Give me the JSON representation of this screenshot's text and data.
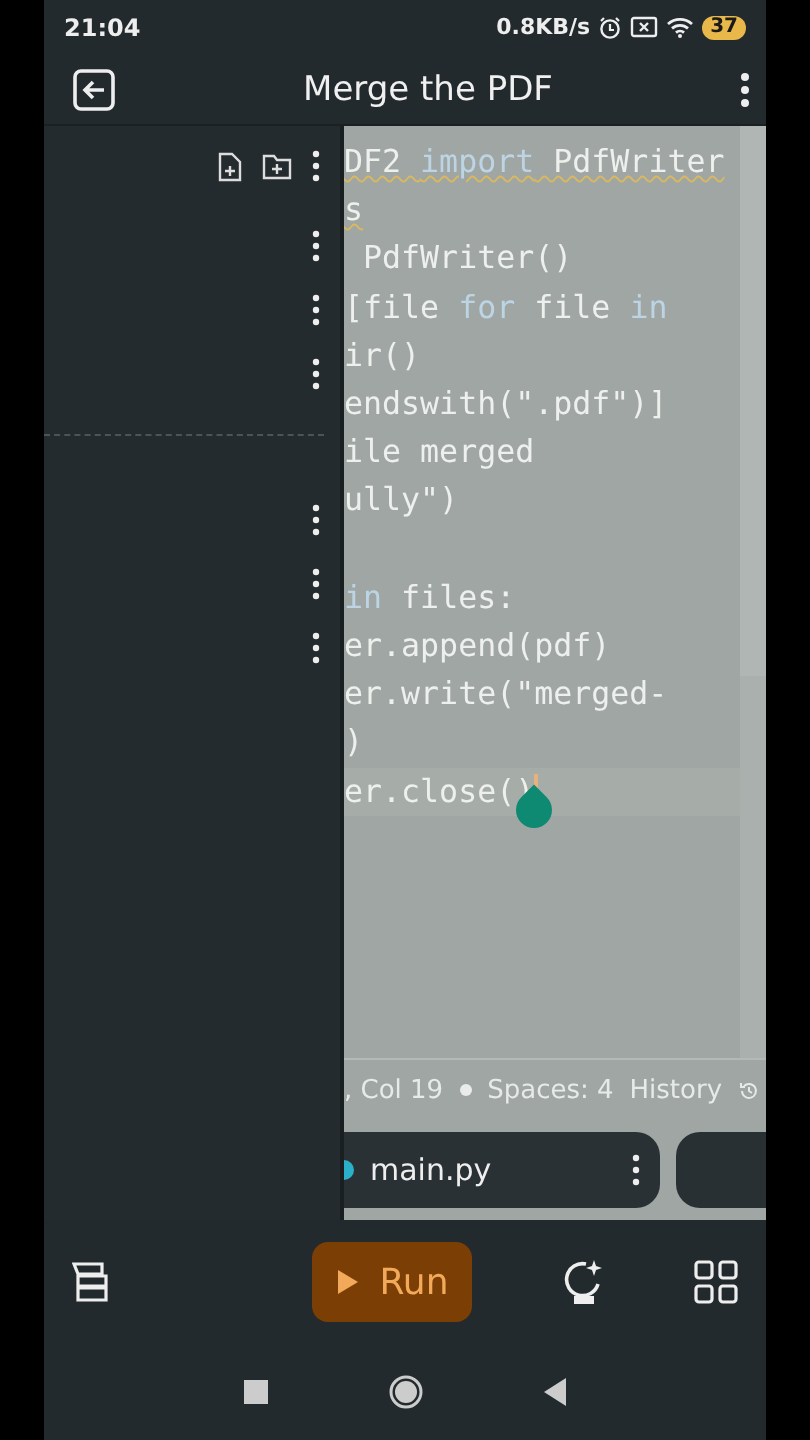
{
  "status_bar": {
    "time": "21:04",
    "speed": "0.8KB/s",
    "battery": "37"
  },
  "header": {
    "title": "Merge the PDF"
  },
  "sidebar": {
    "sections": [
      {
        "rows": [
          {
            "menu": true
          },
          {
            "menu": true
          },
          {
            "menu": true
          }
        ]
      },
      {
        "rows": [
          {
            "menu": true
          },
          {
            "menu": true
          },
          {
            "menu": true
          }
        ]
      }
    ]
  },
  "editor": {
    "lines": [
      {
        "segments": [
          {
            "text": "DF2 ",
            "kind": "plain"
          },
          {
            "text": "import",
            "kind": "keyword"
          },
          {
            "text": " PdfWriter",
            "kind": "plain"
          }
        ],
        "warning": true,
        "current": false,
        "gap_before": false
      },
      {
        "segments": [
          {
            "text": "s",
            "kind": "plain"
          }
        ],
        "warning": true,
        "current": false,
        "gap_before": false
      },
      {
        "segments": [
          {
            "text": " PdfWriter()",
            "kind": "plain"
          }
        ],
        "warning": false,
        "current": false,
        "gap_before": false
      },
      {
        "segments": [
          {
            "text": "[file ",
            "kind": "plain"
          },
          {
            "text": "for",
            "kind": "keyword"
          },
          {
            "text": " file ",
            "kind": "plain"
          },
          {
            "text": "in",
            "kind": "keyword"
          }
        ],
        "warning": false,
        "current": false,
        "gap_before": false
      },
      {
        "segments": [
          {
            "text": "ir()",
            "kind": "plain"
          }
        ],
        "warning": false,
        "current": false,
        "gap_before": false
      },
      {
        "segments": [
          {
            "text": "endswith(\".pdf\")]",
            "kind": "plain"
          }
        ],
        "warning": false,
        "current": false,
        "gap_before": false
      },
      {
        "segments": [
          {
            "text": "ile merged",
            "kind": "plain"
          }
        ],
        "warning": false,
        "current": false,
        "gap_before": false
      },
      {
        "segments": [
          {
            "text": "ully\")",
            "kind": "plain"
          }
        ],
        "warning": false,
        "current": false,
        "gap_before": false
      },
      {
        "segments": [
          {
            "text": "in",
            "kind": "keyword"
          },
          {
            "text": " files:",
            "kind": "plain"
          }
        ],
        "warning": false,
        "current": false,
        "gap_before": true
      },
      {
        "segments": [
          {
            "text": "er.append(pdf)",
            "kind": "plain"
          }
        ],
        "warning": false,
        "current": false,
        "gap_before": false
      },
      {
        "segments": [
          {
            "text": "er.write(\"merged-",
            "kind": "plain"
          }
        ],
        "warning": false,
        "current": false,
        "gap_before": false
      },
      {
        "segments": [
          {
            "text": ")",
            "kind": "plain"
          }
        ],
        "warning": false,
        "current": false,
        "gap_before": false
      },
      {
        "segments": [
          {
            "text": "er.close()",
            "kind": "plain"
          }
        ],
        "warning": false,
        "current": true,
        "gap_before": false
      }
    ],
    "status": {
      "position": ", Col 19",
      "spaces": "Spaces: 4",
      "history": "History"
    }
  },
  "tabs": [
    {
      "label": "main.py",
      "selected": true
    },
    {
      "selected": false
    }
  ],
  "toolbar": {
    "run": "Run"
  }
}
